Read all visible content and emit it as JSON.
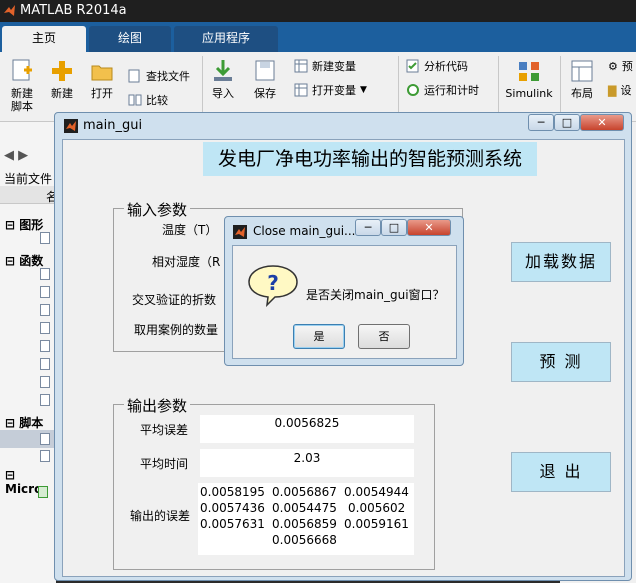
{
  "matlab": {
    "title": "MATLAB R2014a",
    "tabs": [
      "主页",
      "绘图",
      "应用程序"
    ],
    "ribbon": {
      "new_script": "新建\n脚本",
      "new": "新建",
      "open": "打开",
      "find_files": "查找文件",
      "compare": "比较",
      "import": "导入",
      "save": "保存",
      "new_variable": "新建变量",
      "open_variable": "打开变量",
      "clear_workspace": "",
      "analyze_code": "分析代码",
      "run_and_time": "运行和计时",
      "simulink": "Simulink",
      "layout": "布局",
      "preferences": "预",
      "set_path": "设"
    },
    "current_folder_label": "当前文件",
    "name_col": "名",
    "sections": [
      "图形",
      "函数",
      "脚本",
      "Micro"
    ]
  },
  "gui": {
    "window_title": "main_gui",
    "system_title": "发电厂净电功率输出的智能预测系统",
    "input_panel": {
      "title": "输入参数",
      "temperature": "温度（T）",
      "humidity": "相对湿度（R",
      "folds": "交叉验证的折数",
      "case_count": "取用案例的数量"
    },
    "buttons": {
      "load": "加载数据",
      "predict": "预 测",
      "exit": "退 出"
    },
    "output_panel": {
      "title": "输出参数",
      "avg_error_label": "平均误差",
      "avg_error_value": "0.0056825",
      "avg_time_label": "平均时间",
      "avg_time_value": "2.03",
      "errors_label": "输出的误差",
      "errors_rows": [
        [
          "0.0058195",
          "0.0056867",
          "0.0054944"
        ],
        [
          "0.0057436",
          "0.0054475",
          "0.005602"
        ],
        [
          "0.0057631",
          "0.0056859",
          "0.0059161"
        ],
        [
          "",
          "0.0056668",
          ""
        ]
      ]
    }
  },
  "dialog": {
    "title": "Close main_gui...",
    "message": "是否关闭main_gui窗口？",
    "yes": "是",
    "no": "否"
  }
}
